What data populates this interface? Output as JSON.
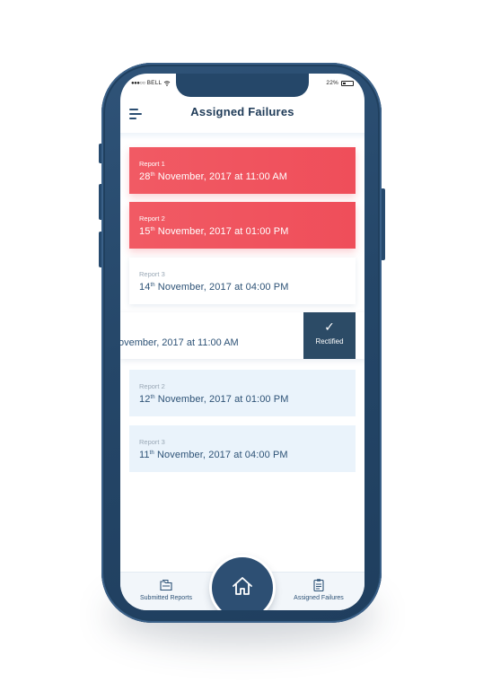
{
  "status_bar": {
    "carrier": "BELL",
    "signal": "●●●○○",
    "battery": "22%"
  },
  "header": {
    "title": "Assigned Failures"
  },
  "reports": [
    {
      "label": "Report 1",
      "day": "28",
      "suffix": "th",
      "rest": " November, 2017 at 11:00 AM",
      "style": "red"
    },
    {
      "label": "Report 2",
      "day": "15",
      "suffix": "th",
      "rest": " November, 2017 at 01:00 PM",
      "style": "red"
    },
    {
      "label": "Report 3",
      "day": "14",
      "suffix": "th",
      "rest": " November, 2017 at 04:00 PM",
      "style": "white"
    }
  ],
  "swiped_row": {
    "date": "ovember, 2017 at 11:00 AM",
    "action_label": "Rectified"
  },
  "reports_lower": [
    {
      "label": "Report 2",
      "day": "12",
      "suffix": "th",
      "rest": " November, 2017 at 01:00 PM"
    },
    {
      "label": "Report 3",
      "day": "11",
      "suffix": "th",
      "rest": " November, 2017 at 04:00 PM"
    }
  ],
  "bottom_nav": {
    "left_label": "Submitted Reports",
    "right_label": "Assigned Failures"
  },
  "colors": {
    "accent_red": "#f15a64",
    "primary_navy": "#2d4f73",
    "text_blue": "#2d5276"
  },
  "icons": {
    "menu": "hamburger-icon",
    "check": "check-icon",
    "home": "home-icon",
    "submitted": "folder-icon",
    "assigned": "clipboard-icon"
  }
}
